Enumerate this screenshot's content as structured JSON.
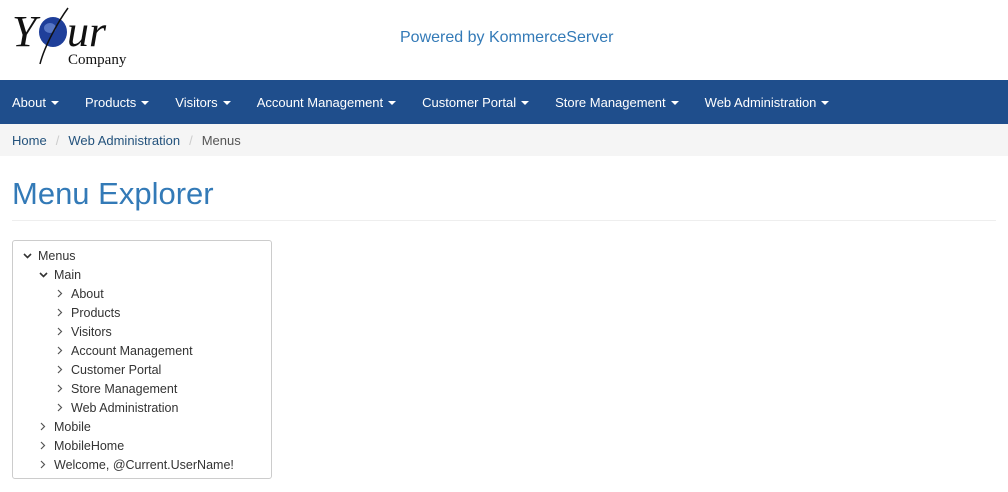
{
  "logo": {
    "main_text": "Your",
    "sub_text": "Company",
    "accent_color": "#1f3f9a"
  },
  "header": {
    "powered_by": "Powered by KommerceServer"
  },
  "nav": {
    "items": [
      {
        "label": "About"
      },
      {
        "label": "Products"
      },
      {
        "label": "Visitors"
      },
      {
        "label": "Account Management"
      },
      {
        "label": "Customer Portal"
      },
      {
        "label": "Store Management"
      },
      {
        "label": "Web Administration"
      }
    ],
    "background": "#1f4e8c"
  },
  "breadcrumb": {
    "items": [
      {
        "label": "Home"
      },
      {
        "label": "Web Administration"
      }
    ],
    "separator": "/",
    "active": "Menus"
  },
  "page": {
    "title": "Menu Explorer"
  },
  "tree": {
    "root": {
      "label": "Menus",
      "expanded": true
    },
    "main": {
      "label": "Main",
      "expanded": true
    },
    "main_children": [
      {
        "label": "About"
      },
      {
        "label": "Products"
      },
      {
        "label": "Visitors"
      },
      {
        "label": "Account Management"
      },
      {
        "label": "Customer Portal"
      },
      {
        "label": "Store Management"
      },
      {
        "label": "Web Administration"
      }
    ],
    "siblings": [
      {
        "label": "Mobile"
      },
      {
        "label": "MobileHome"
      },
      {
        "label": "Welcome, @Current.UserName!"
      }
    ]
  }
}
